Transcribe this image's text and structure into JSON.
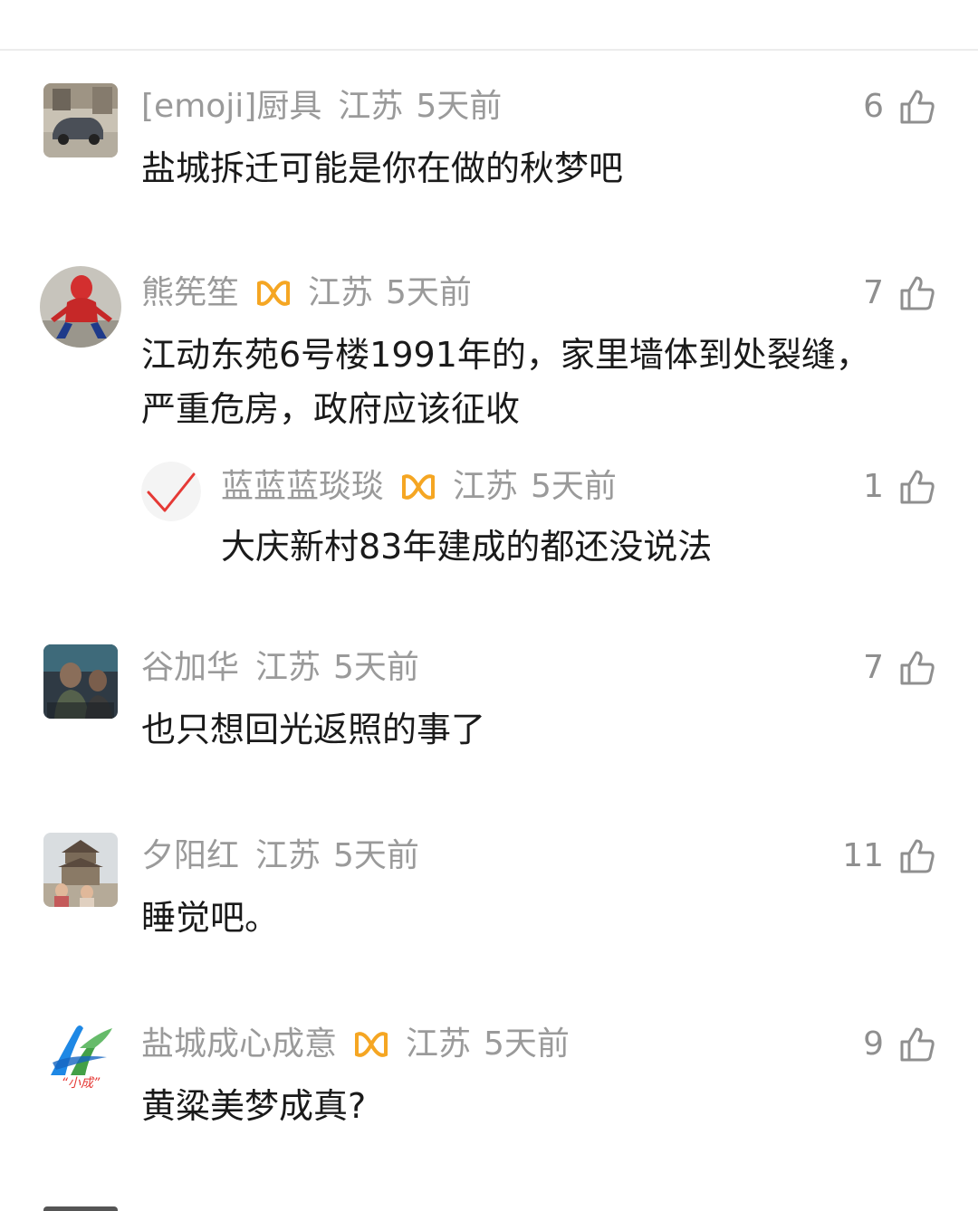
{
  "comments": [
    {
      "username": "[emoji]厨具",
      "location": "江苏",
      "time": "5天前",
      "likes": "6",
      "lines": [
        "盐城拆迁可能是你在做的秋梦吧"
      ],
      "avatar_icon": "car-photo-avatar"
    },
    {
      "username": "熊筅笙",
      "location": "江苏",
      "time": "5天前",
      "likes": "7",
      "lines": [
        "江动东苑6号楼1991年的，家里墙体到处裂缝，",
        "严重危房，政府应该征收"
      ],
      "avatar_icon": "spiderman-avatar",
      "badge": "vip-badge-icon",
      "reply": {
        "username": "蓝蓝蓝琰琰",
        "location": "江苏",
        "time": "5天前",
        "likes": "1",
        "lines": [
          "大庆新村83年建成的都还没说法"
        ],
        "avatar_icon": "checkmark-avatar",
        "badge": "vip-badge-icon"
      }
    },
    {
      "username": "谷加华",
      "location": "江苏",
      "time": "5天前",
      "likes": "7",
      "lines": [
        "也只想回光返照的事了"
      ],
      "avatar_icon": "people-photo-avatar"
    },
    {
      "username": "夕阳红",
      "location": "江苏",
      "time": "5天前",
      "likes": "11",
      "lines": [
        "睡觉吧。"
      ],
      "avatar_icon": "tower-photo-avatar"
    },
    {
      "username": "盐城成心成意",
      "location": "江苏",
      "time": "5天前",
      "likes": "9",
      "lines": [
        "黄粱美梦成真?"
      ],
      "avatar_icon": "logo-avatar",
      "badge": "vip-badge-icon",
      "avatar_caption": "“小成”"
    }
  ],
  "colors": {
    "meta_text": "#9a9a9a",
    "body_text": "#1a1a1a",
    "badge": "#f5a623",
    "check": "#e53935"
  }
}
